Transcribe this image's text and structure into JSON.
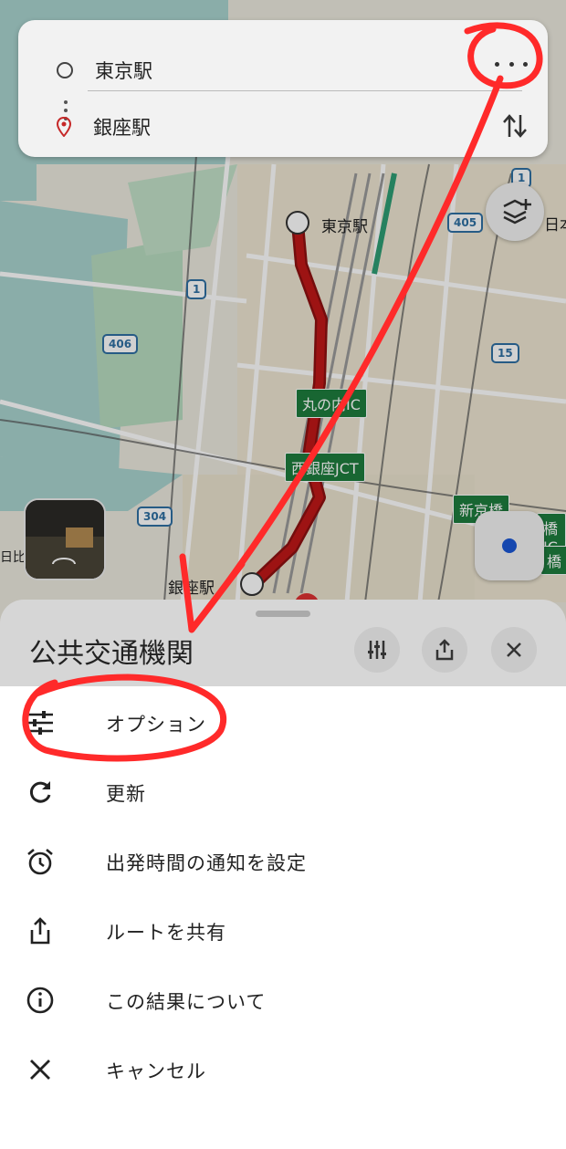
{
  "route": {
    "origin": "東京駅",
    "destination": "銀座駅"
  },
  "map": {
    "labels": {
      "tokyo_station": "東京駅",
      "ginza_station": "銀座駅",
      "marunouchi_ic": "丸の内IC",
      "nishi_ginza_jct": "西銀座JCT",
      "shinkyobashi": "新京橋",
      "nihon_partial": "日本",
      "bashi_partial": "橋",
      "kyobashi_partial": "橋JC",
      "hibiya_partial": "日比谷"
    },
    "shields": [
      "1",
      "405",
      "406",
      "1",
      "15",
      "304"
    ]
  },
  "sheet": {
    "title": "公共交通機関"
  },
  "menu": {
    "items": [
      {
        "label": "オプション",
        "icon": "tune-icon"
      },
      {
        "label": "更新",
        "icon": "refresh-icon"
      },
      {
        "label": "出発時間の通知を設定",
        "icon": "alarm-icon"
      },
      {
        "label": "ルートを共有",
        "icon": "share-icon"
      },
      {
        "label": "この結果について",
        "icon": "info-icon"
      },
      {
        "label": "キャンセル",
        "icon": "close-icon"
      }
    ]
  },
  "colors": {
    "route": "#c01818",
    "annotation": "#ff2a2a",
    "accent": "#1a57d6"
  }
}
